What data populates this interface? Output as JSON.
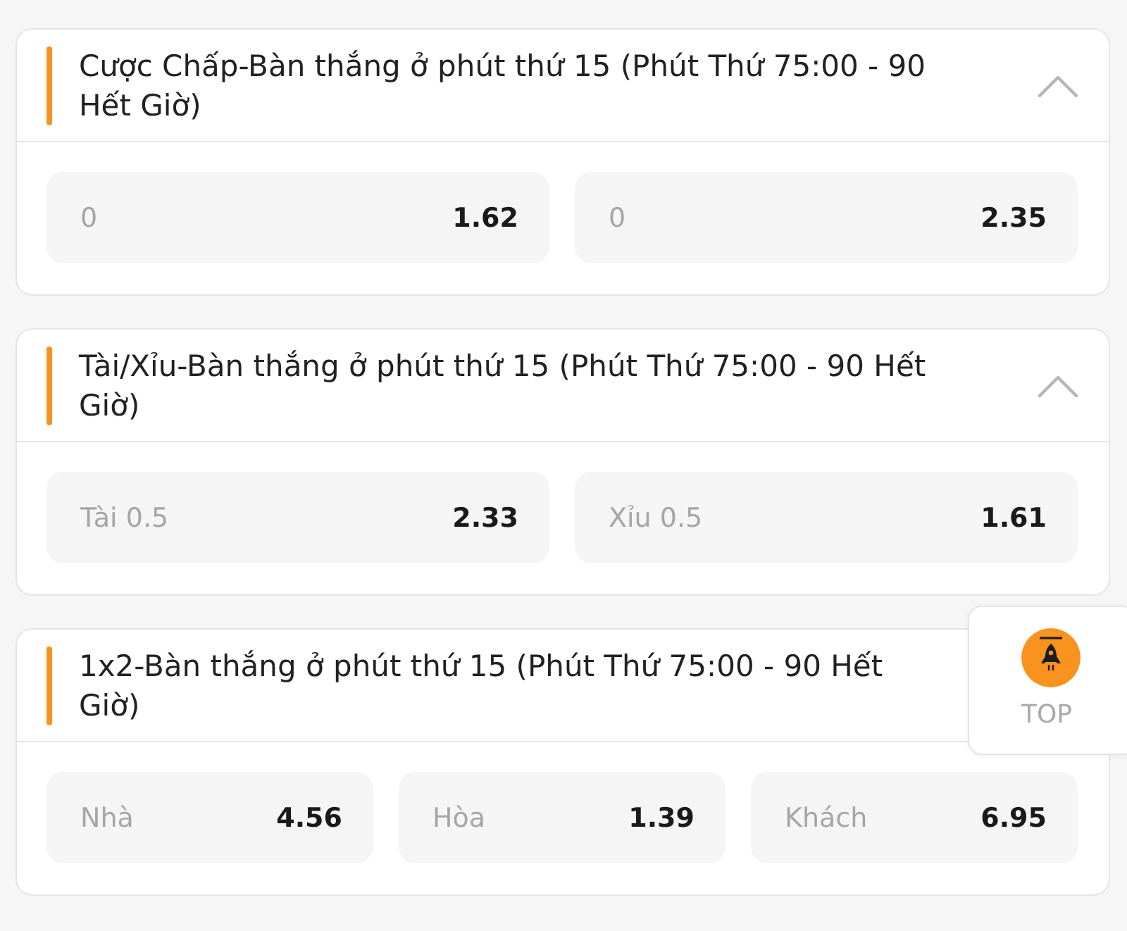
{
  "markets": [
    {
      "title": "Cược Chấp-Bàn thắng ở phút thứ 15 (Phút Thứ 75:00 - 90 Hết Giờ)",
      "expanded": true,
      "odds": [
        {
          "label": "0",
          "value": "1.62"
        },
        {
          "label": "0",
          "value": "2.35"
        }
      ]
    },
    {
      "title": "Tài/Xỉu-Bàn thắng ở phút thứ 15 (Phút Thứ 75:00 - 90 Hết Giờ)",
      "expanded": true,
      "odds": [
        {
          "label": "Tài 0.5",
          "value": "2.33"
        },
        {
          "label": "Xỉu 0.5",
          "value": "1.61"
        }
      ]
    },
    {
      "title": "1x2-Bàn thắng ở phút thứ 15 (Phút Thứ 75:00 - 90 Hết Giờ)",
      "odds": [
        {
          "label": "Nhà",
          "value": "4.56"
        },
        {
          "label": "Hòa",
          "value": "1.39"
        },
        {
          "label": "Khách",
          "value": "6.95"
        }
      ]
    }
  ],
  "back_to_top": {
    "label": "TOP"
  }
}
